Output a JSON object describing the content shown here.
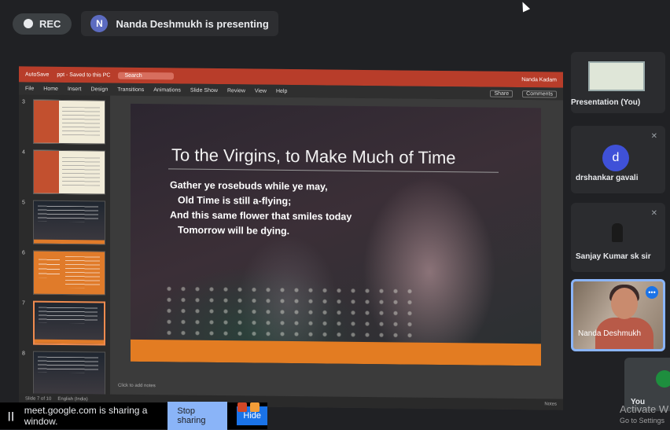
{
  "meet": {
    "rec_label": "REC",
    "presenter_initial": "N",
    "presenter_text": "Nanda Deshmukh is presenting"
  },
  "ppt": {
    "autosave": "AutoSave",
    "file_title": "ppt - Saved to this PC",
    "search": "Search",
    "user": "Nanda Kadam",
    "menu": [
      "File",
      "Home",
      "Insert",
      "Design",
      "Transitions",
      "Animations",
      "Slide Show",
      "Review",
      "View",
      "Help"
    ],
    "share": "Share",
    "comments": "Comments",
    "thumb_numbers": [
      "3",
      "4",
      "5",
      "6",
      "7",
      "8"
    ],
    "slide_title": "To the Virgins, to Make Much of Time",
    "poem": [
      "Gather ye rosebuds while ye may,",
      "Old Time is still a-flying;",
      "And this same flower that smiles today",
      "Tomorrow will be dying."
    ],
    "notes_placeholder": "Click to add notes",
    "status_slide": "Slide 7 of 10",
    "status_lang": "English (India)",
    "notes_btn": "Notes"
  },
  "share_bar": {
    "pause_icon": "pause-icon",
    "text": "meet.google.com is sharing a window.",
    "stop_label": "Stop sharing",
    "hide_label": "Hide"
  },
  "participants": [
    {
      "name": "Presentation (You)"
    },
    {
      "name": "drshankar gavali",
      "initial": "d"
    },
    {
      "name": "Sanjay Kumar sk sir"
    },
    {
      "name": "Nanda Deshmukh"
    },
    {
      "name": "You"
    }
  ],
  "watermark": {
    "line1": "Activate W",
    "line2": "Go to Settings"
  },
  "colors": {
    "meet_bg": "#202124",
    "accent_blue": "#8ab4f8",
    "ppt_red": "#b83d2a",
    "slide_orange": "#e37c22"
  }
}
